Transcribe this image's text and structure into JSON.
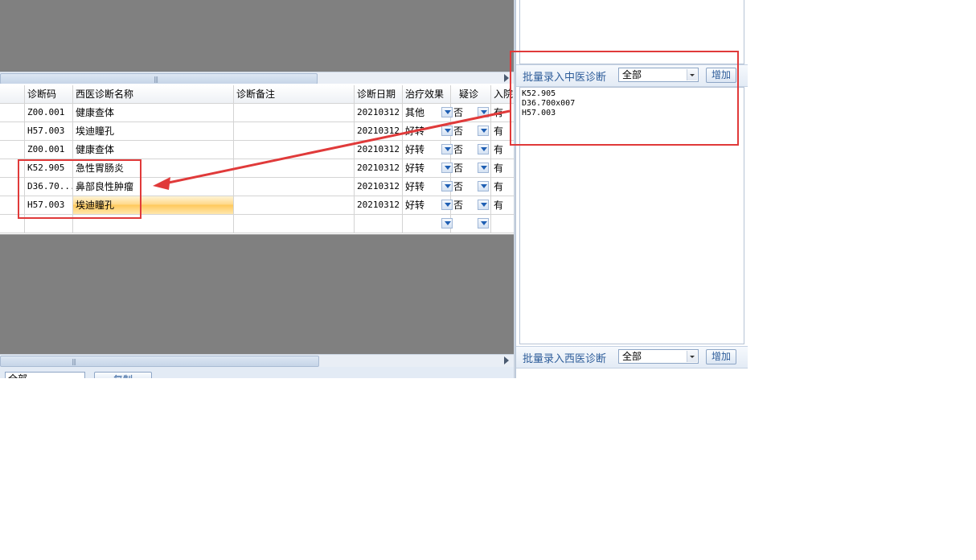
{
  "grid": {
    "columns": [
      "诊断码",
      "西医诊断名称",
      "诊断备注",
      "诊断日期",
      "治疗效果",
      "疑诊",
      "入院"
    ],
    "rows": [
      {
        "code": "Z00.001",
        "name": "健康查体",
        "note": "",
        "date": "20210312",
        "effect": "其他",
        "suspect": "否",
        "admit": "有"
      },
      {
        "code": "H57.003",
        "name": "埃迪瞳孔",
        "note": "",
        "date": "20210312",
        "effect": "好转",
        "suspect": "否",
        "admit": "有"
      },
      {
        "code": "Z00.001",
        "name": "健康查体",
        "note": "",
        "date": "20210312",
        "effect": "好转",
        "suspect": "否",
        "admit": "有"
      },
      {
        "code": "K52.905",
        "name": "急性胃肠炎",
        "note": "",
        "date": "20210312",
        "effect": "好转",
        "suspect": "否",
        "admit": "有"
      },
      {
        "code": "D36.70...",
        "name": "鼻部良性肿瘤",
        "note": "",
        "date": "20210312",
        "effect": "好转",
        "suspect": "否",
        "admit": "有"
      },
      {
        "code": "H57.003",
        "name": "埃迪瞳孔",
        "note": "",
        "date": "20210312",
        "effect": "好转",
        "suspect": "否",
        "admit": "有"
      }
    ]
  },
  "bottom_toolbar": {
    "filter_value": "全部",
    "copy_label": "复制"
  },
  "tcm_batch": {
    "label": "批量录入中医诊断",
    "filter_value": "全部",
    "add_label": "增加"
  },
  "batch_text": "K52.905\nD36.700x007\nH57.003",
  "wm_batch": {
    "label": "批量录入西医诊断",
    "filter_value": "全部",
    "add_label": "增加"
  },
  "colors": {
    "annotation": "#e03a3a",
    "accent": "#2e5d9a",
    "selected_cell": "#ffd98a"
  }
}
